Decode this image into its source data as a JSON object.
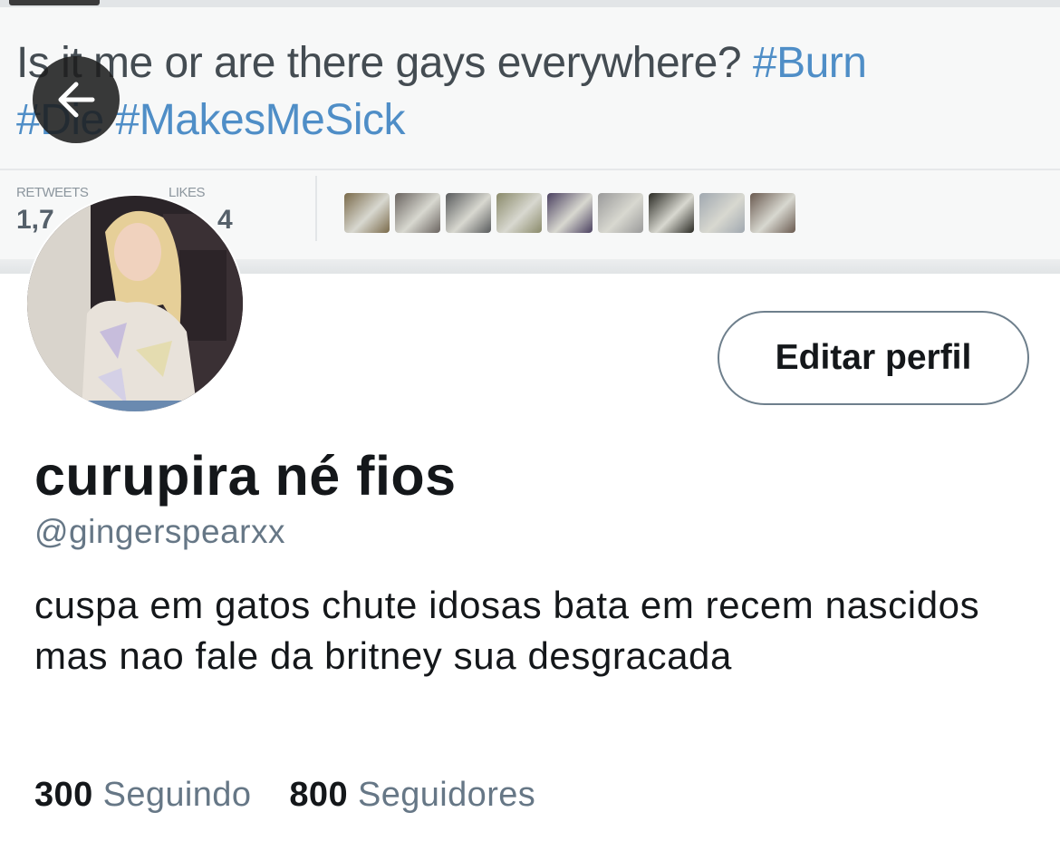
{
  "banner": {
    "tweet_text": "Is it me or are there gays everywhere?",
    "hashtags": [
      "#Burn",
      "#Die",
      "#MakesMeSick"
    ],
    "retweets_label": "RETWEETS",
    "retweets_value": "1,7",
    "likes_label": "LIKES",
    "likes_value": "4",
    "liker_colors": [
      "#7a6a4a",
      "#6a6460",
      "#585a5c",
      "#8a8a6a",
      "#4a4060",
      "#9a9a9a",
      "#2a2a24",
      "#a0a8b0",
      "#6a5a50"
    ]
  },
  "nav": {
    "back_icon": "arrow-left-icon"
  },
  "profile": {
    "edit_button": "Editar perfil",
    "display_name": "curupira né fios",
    "handle": "@gingerspearxx",
    "bio": "cuspa em gatos chute idosas bata em recem nascidos mas nao fale da britney sua desgracada",
    "following_count": "300",
    "following_label": "Seguindo",
    "followers_count": "800",
    "followers_label": "Seguidores"
  },
  "colors": {
    "text_primary": "#14171a",
    "text_secondary": "#667786",
    "hashtag": "#4f8ec7",
    "banner_bg": "#f7f8f8"
  }
}
